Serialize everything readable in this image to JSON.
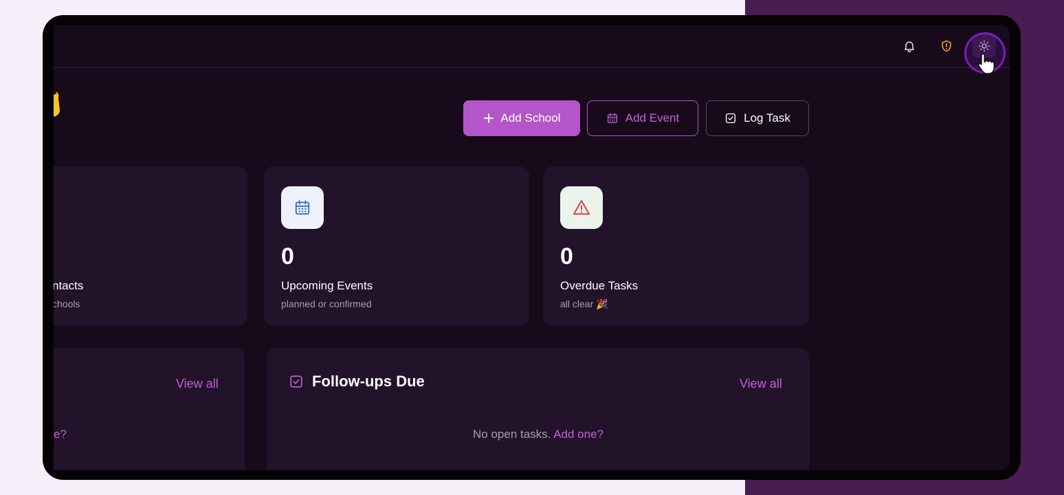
{
  "actions": {
    "add_school": "Add School",
    "add_event": "Add Event",
    "log_task": "Log Task"
  },
  "stats": [
    {
      "value": "",
      "label": "ntacts",
      "sub": "chools"
    },
    {
      "value": "0",
      "label": "Upcoming Events",
      "sub": "planned or confirmed",
      "icon": "calendar-icon"
    },
    {
      "value": "0",
      "label": "Overdue Tasks",
      "sub": "all clear 🎉",
      "icon": "alert-triangle-icon"
    }
  ],
  "panels": {
    "left": {
      "view_all": "View all",
      "fragment": "e?"
    },
    "followups": {
      "title": "Follow-ups Due",
      "view_all": "View all",
      "empty_text": "No open tasks.",
      "empty_link": "Add one?"
    }
  },
  "icons": {
    "top_bar": [
      "bell-icon",
      "shield-alert-icon",
      "sun-icon"
    ],
    "cursor": "hand-pointer-icon"
  },
  "colors": {
    "accent": "#b455c9",
    "background": "#160a1b",
    "card": "#22122a",
    "warning": "#f0a020",
    "danger": "#e0484c",
    "calendar": "#2f6fd6"
  }
}
